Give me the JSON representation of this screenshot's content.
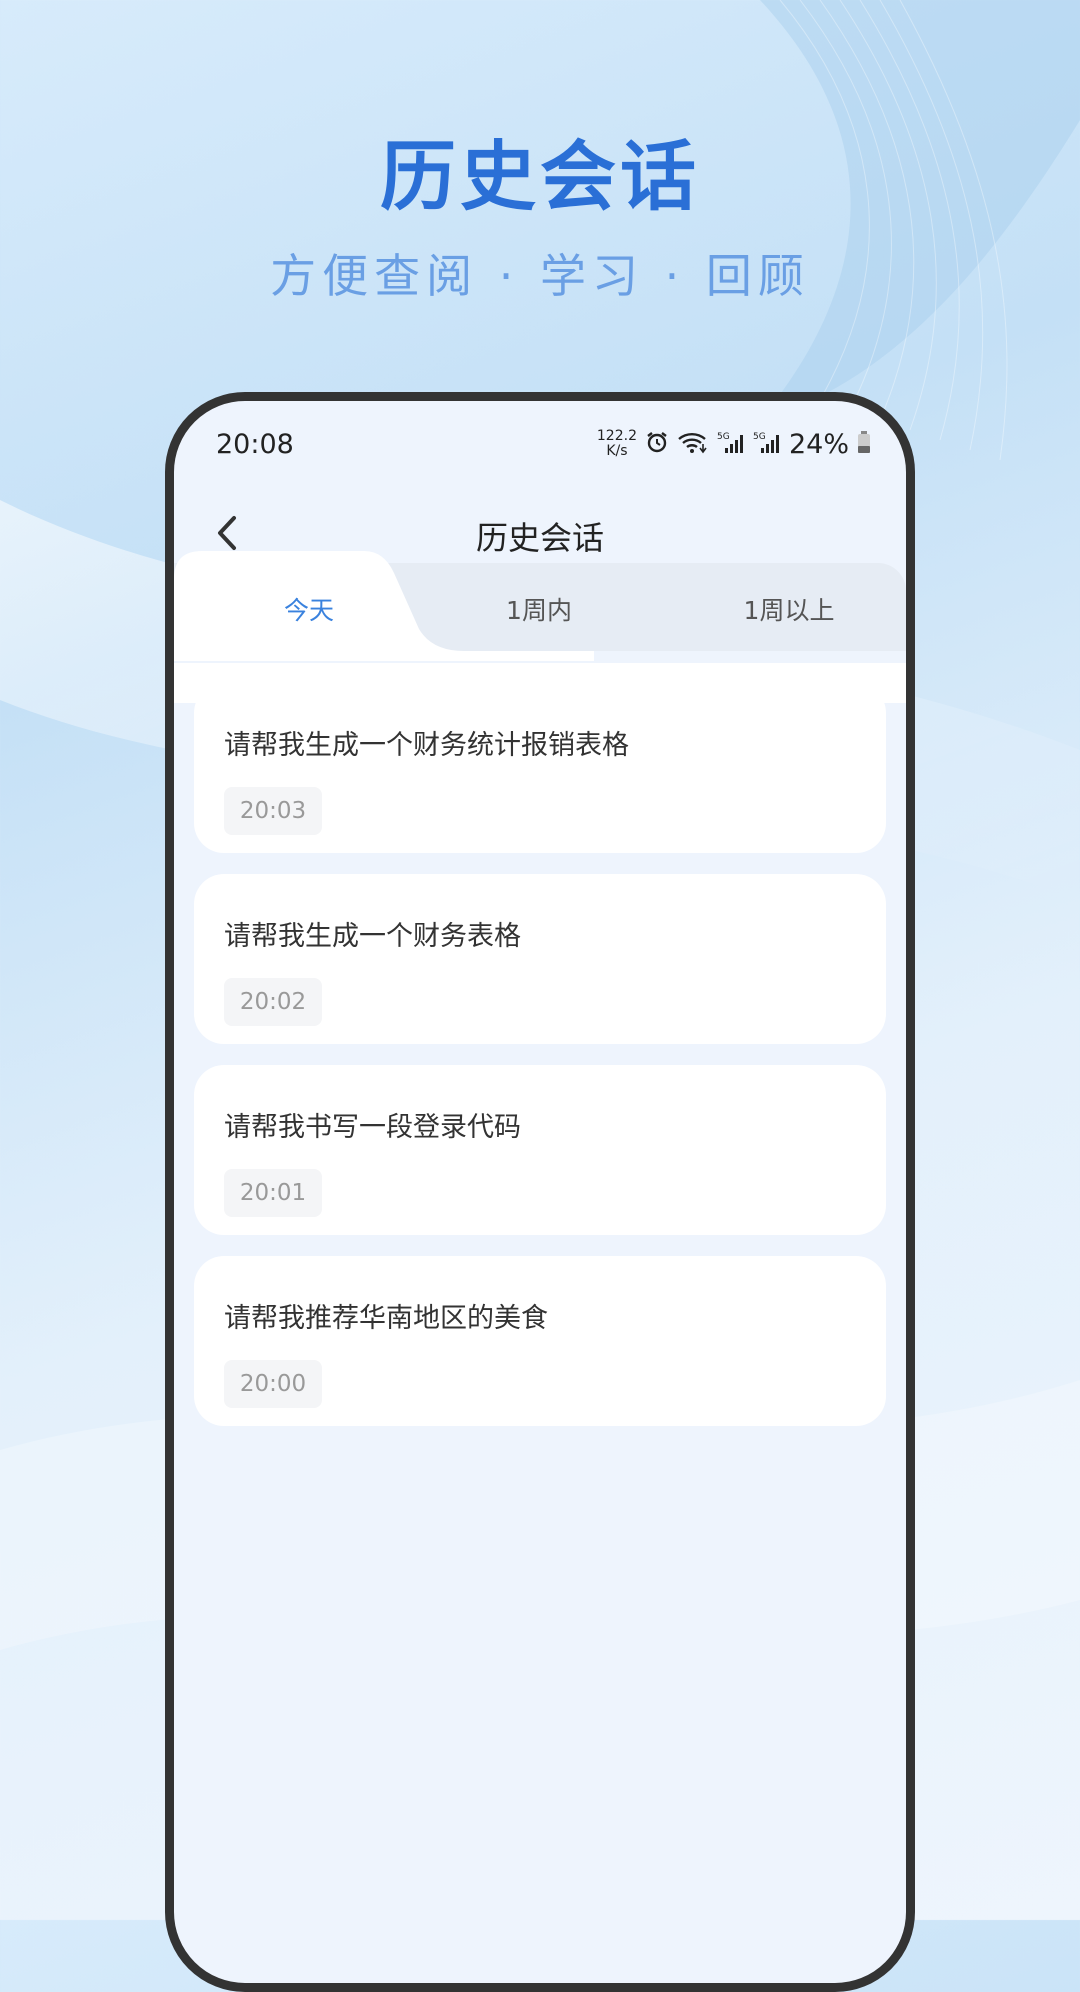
{
  "promo": {
    "title": "历史会话",
    "subtitle": "方便查阅 · 学习 · 回顾"
  },
  "statusbar": {
    "time": "20:08",
    "speed_value": "122.2",
    "speed_unit": "K/s",
    "battery": "24%",
    "icons": [
      "alarm-icon",
      "wifi-icon",
      "signal-5g-icon",
      "signal-5g-icon",
      "battery-icon"
    ]
  },
  "nav": {
    "title": "历史会话",
    "back_icon": "chevron-left-icon"
  },
  "tabs": [
    {
      "label": "今天",
      "active": true
    },
    {
      "label": "1周内",
      "active": false
    },
    {
      "label": "1周以上",
      "active": false
    }
  ],
  "conversations": [
    {
      "title": "请帮我生成一个财务统计报销表格",
      "time": "20:03"
    },
    {
      "title": "请帮我生成一个财务表格",
      "time": "20:02"
    },
    {
      "title": "请帮我书写一段登录代码",
      "time": "20:01"
    },
    {
      "title": "请帮我推荐华南地区的美食",
      "time": "20:00"
    }
  ],
  "colors": {
    "accent": "#2a6fd6",
    "subtitle": "#6a9fe4",
    "tab_active": "#3a82de",
    "phone_bg": "#eef4fd"
  }
}
